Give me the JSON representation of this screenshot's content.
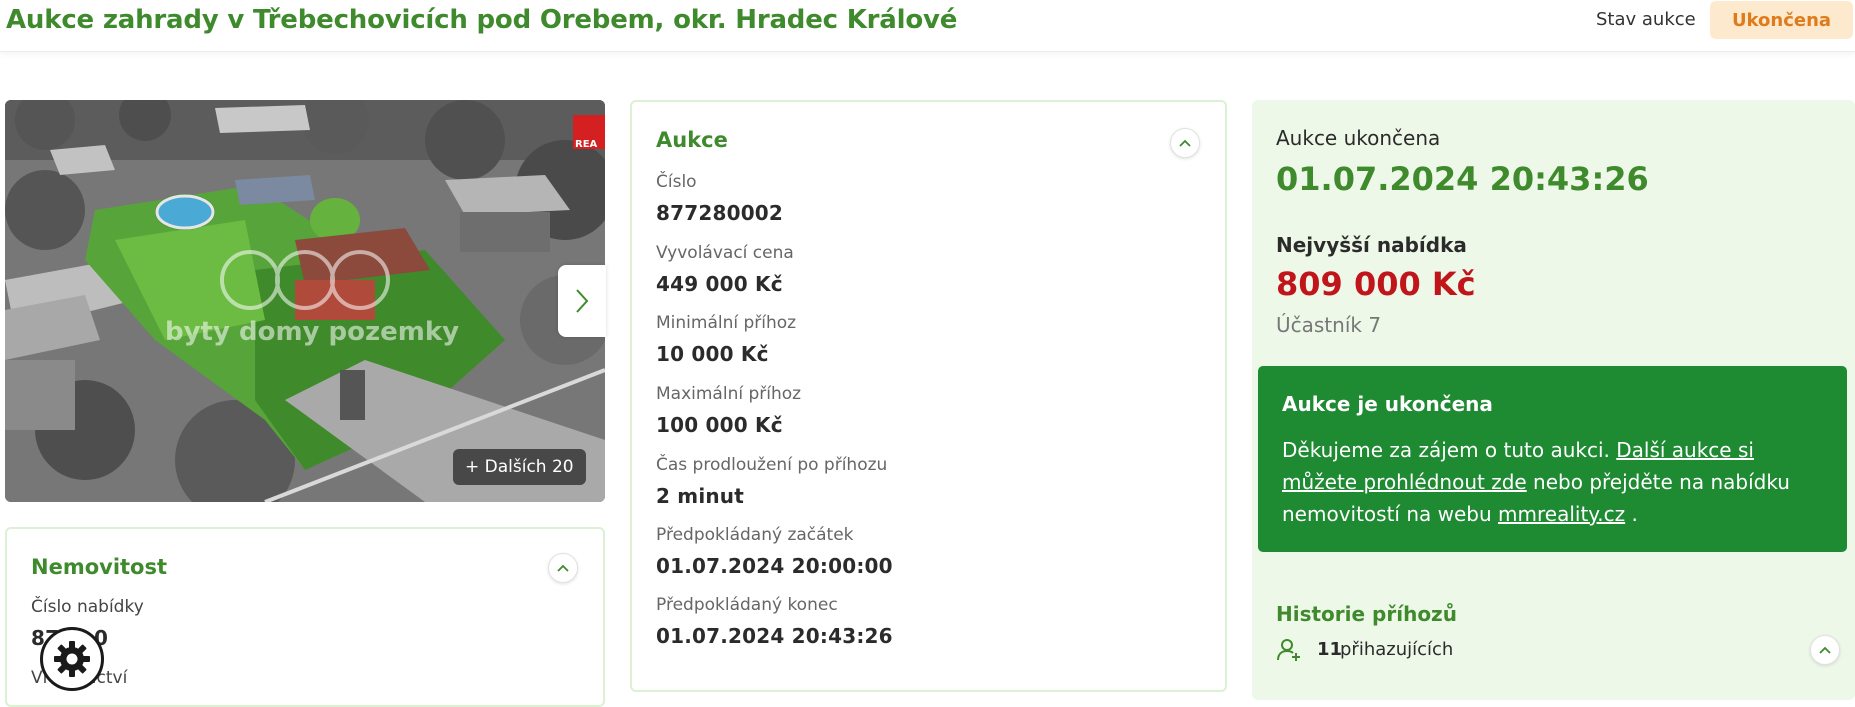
{
  "header": {
    "title": "Aukce zahrady v Třebechovicích pod Orebem, okr. Hradec Králové",
    "status_label": "Stav aukce",
    "status_value": "Ukončena"
  },
  "gallery": {
    "more_photos": "+ Dalších 20",
    "watermark": "byty domy pozemky",
    "corner_logo": "REA"
  },
  "auction": {
    "title": "Aukce",
    "fields": [
      {
        "label": "Číslo",
        "value": "877280002"
      },
      {
        "label": "Vyvolávací cena",
        "value": "449 000 Kč"
      },
      {
        "label": "Minimální příhoz",
        "value": "10 000 Kč"
      },
      {
        "label": "Maximální příhoz",
        "value": "100 000 Kč"
      },
      {
        "label": "Čas prodloužení po příhozu",
        "value": "2 minut"
      },
      {
        "label": "Předpokládaný začátek",
        "value": "01.07.2024 20:00:00"
      },
      {
        "label": "Předpokládaný konec",
        "value": "01.07.2024 20:43:26"
      }
    ]
  },
  "property": {
    "title": "Nemovitost",
    "offer_label": "Číslo nabídky",
    "offer_value_start": "87",
    "offer_value_end": "0",
    "ownership_start": "Vl",
    "ownership_end": "nictví"
  },
  "side": {
    "ended_label": "Aukce ukončena",
    "ended_datetime": "01.07.2024 20:43:26",
    "top_bid_label": "Nejvyšší nabídka",
    "top_bid_value": "809 000 Kč",
    "top_bidder": "Účastník 7",
    "notice_title": "Aukce je ukončena",
    "notice_text_1": "Děkujeme za zájem o tuto aukci. ",
    "notice_link_1": "Další aukce si můžete prohlédnout zde",
    "notice_text_2": " nebo přejděte na nabídku nemovitostí na webu ",
    "notice_link_2": "mmreality.cz",
    "notice_text_3": " .",
    "history_title": "Historie příhozů",
    "bidders_count": "11",
    "bidders_label": "přihazujících"
  },
  "colors": {
    "brand_green": "#3e8a2c",
    "notice_green": "#1e8a32",
    "price_red": "#c0161b",
    "badge_bg": "#fde9cd",
    "badge_text": "#e07b1c",
    "panel_bg": "#eef8e9"
  },
  "icons": {
    "gallery_next": "chevron-right-icon",
    "collapse": "chevron-up-icon",
    "bidders": "user-plus-icon",
    "settings": "gear-icon"
  }
}
